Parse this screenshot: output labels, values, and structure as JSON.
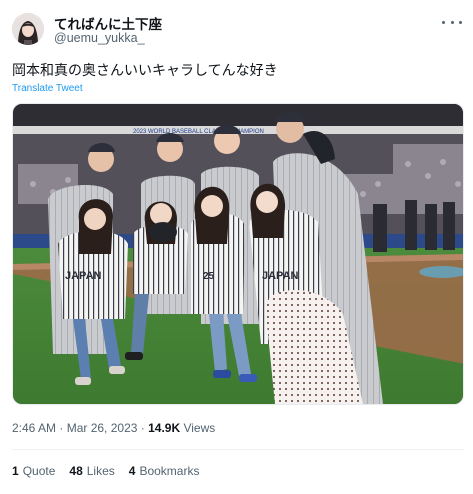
{
  "user": {
    "display_name": "てればんに土下座",
    "handle": "@uemu_yukka_"
  },
  "tweet": {
    "text": "岡本和真の奥さんいいキャラしてんな好き",
    "translate_label": "Translate Tweet",
    "time": "2:46 AM",
    "separator": " · ",
    "date": "Mar 26, 2023",
    "views_count": "14.9K",
    "views_label": "Views"
  },
  "media": {
    "stadium_banner": "2023 WORLD BASEBALL CLASSIC CHAMPION",
    "jersey_text": "JAPAN",
    "jersey_number": "25"
  },
  "stats": [
    {
      "count": "1",
      "label": "Quote"
    },
    {
      "count": "48",
      "label": "Likes"
    },
    {
      "count": "4",
      "label": "Bookmarks"
    }
  ],
  "icons": {
    "more": "more-horizontal-icon"
  }
}
